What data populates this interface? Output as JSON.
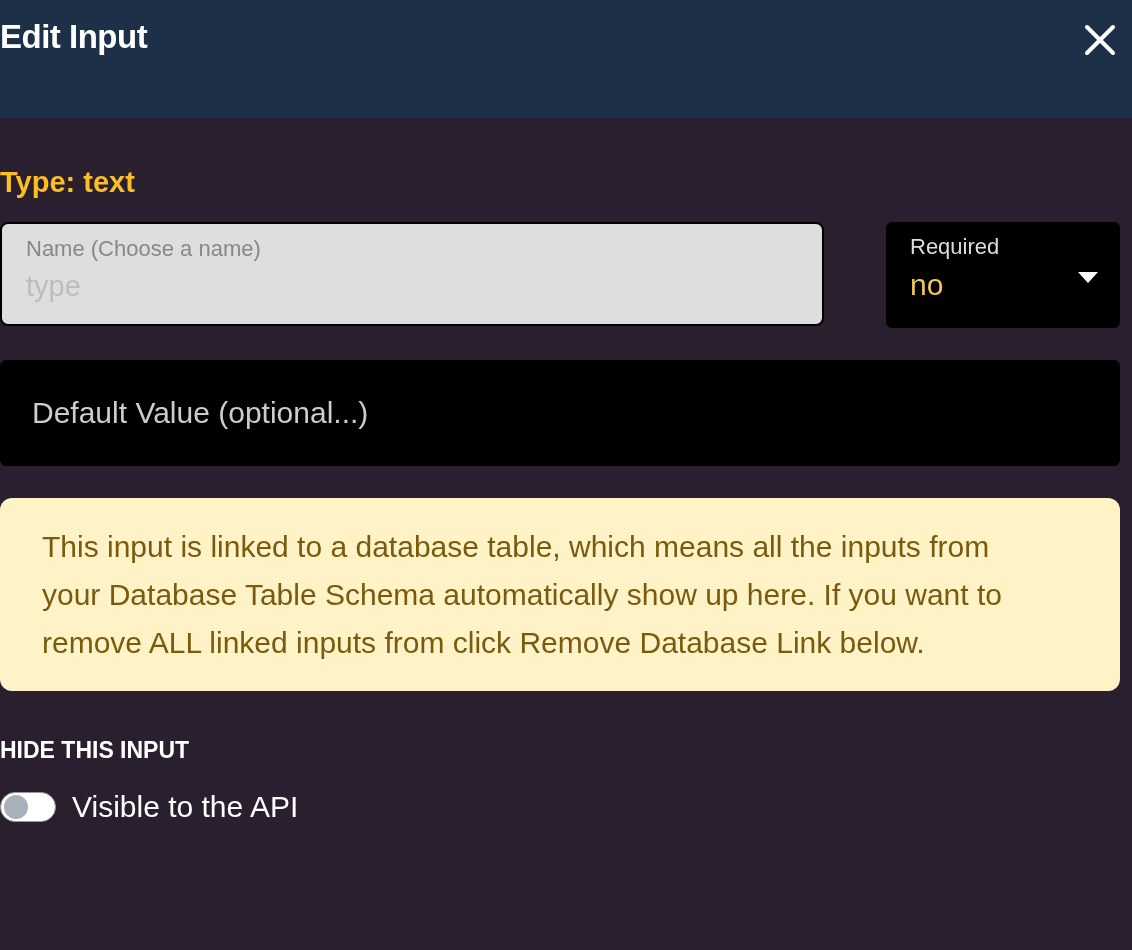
{
  "header": {
    "title": "Edit Input"
  },
  "type_label": "Type: text",
  "name_field": {
    "label": "Name (Choose a name)",
    "value": "type",
    "disabled": true
  },
  "required_select": {
    "label": "Required",
    "value": "no"
  },
  "default_field": {
    "placeholder": "Default Value (optional...)"
  },
  "notice": "This input is linked to a database table, which means all the inputs from your Database Table Schema automatically show up here. If you want to remove ALL linked inputs from click Remove Database Link below.",
  "hide_section": {
    "heading": "HIDE THIS INPUT",
    "toggle": {
      "label": "Visible to the API",
      "on": false
    }
  }
}
